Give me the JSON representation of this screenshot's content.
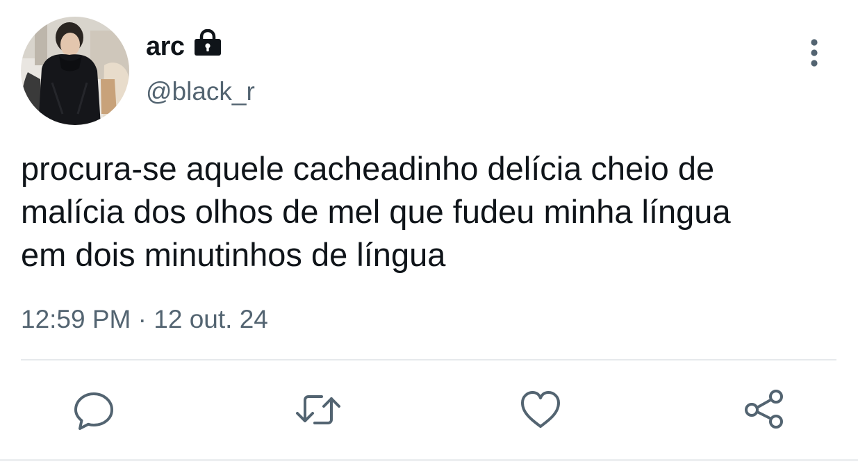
{
  "user": {
    "display_name": "arc",
    "handle": "@black_r",
    "avatar_icon": "profile-photo",
    "protected_icon": "lock-icon"
  },
  "tweet": {
    "text_lines": [
      "procura-se aquele cacheadinho delícia cheio de",
      "malícia dos olhos de mel que fudeu minha língua",
      "em dois minutinhos de língua"
    ],
    "time": "12:59 PM",
    "separator": "·",
    "date": "12 out. 24"
  },
  "actions": [
    {
      "name": "reply",
      "icon": "speech-bubble-icon"
    },
    {
      "name": "retweet",
      "icon": "retweet-arrows-icon"
    },
    {
      "name": "like",
      "icon": "heart-icon"
    },
    {
      "name": "share",
      "icon": "share-nodes-icon"
    }
  ],
  "colors": {
    "text_primary": "#0f1419",
    "text_secondary": "#536471",
    "icon": "#536471",
    "divider": "#e6e9ec"
  }
}
